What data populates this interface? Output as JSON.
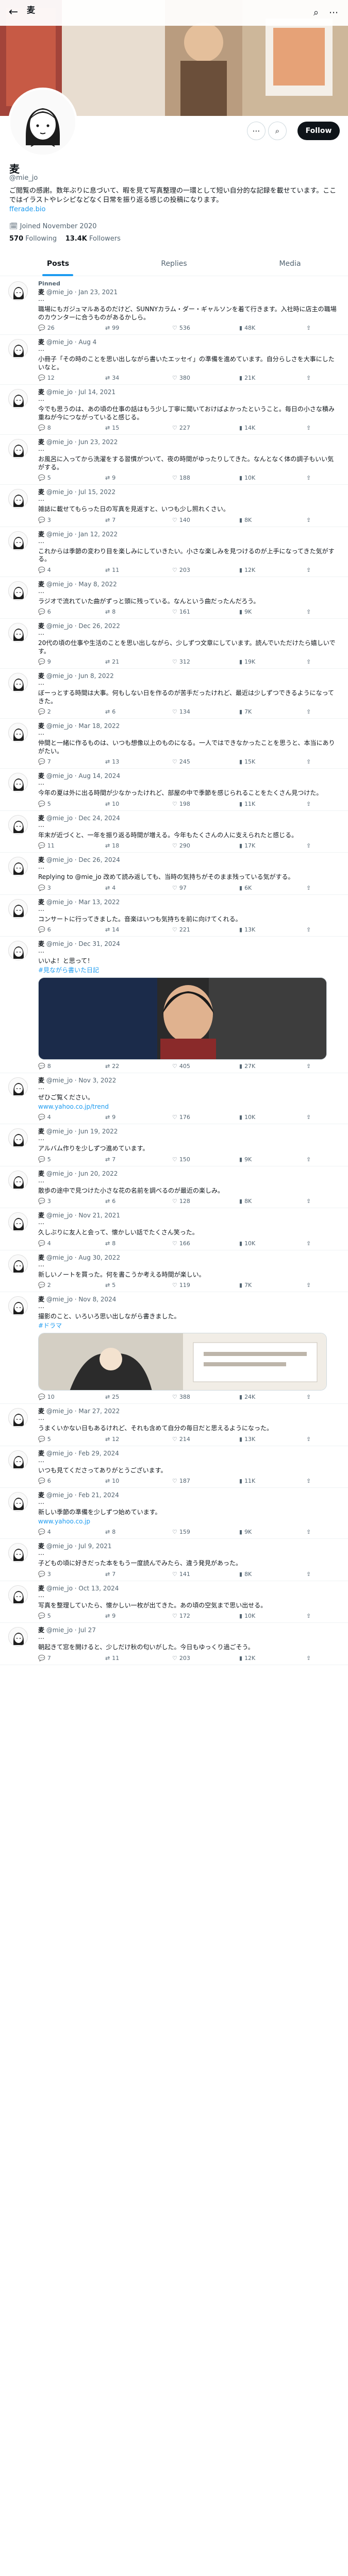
{
  "header": {
    "title": "麦",
    "subtitle": "",
    "back": "←",
    "search": "⌕",
    "more": "⋯"
  },
  "profile": {
    "name": "麦",
    "handle": "@mie_jo",
    "bio": "ご閲覧の感謝。数年ぶりに息づいて、暇を見て写真整理の一環として短い自分的な記録を載せています。ここではイラストやレシピなどなく日常を振り返る感じの投稿になります。",
    "link": "fferade.bio",
    "joined": "Joined November 2020",
    "following": "570",
    "following_label": "Following",
    "followers": "13.4K",
    "followers_label": "Followers",
    "follow_button": "Follow",
    "more_icon": "⋯",
    "search_icon": "⌕",
    "bell_icon": "🔔"
  },
  "tabs": [
    {
      "label": "Posts"
    },
    {
      "label": "Replies"
    },
    {
      "label": "Media"
    }
  ],
  "tweets": [
    {
      "pinned": "Pinned",
      "name": "麦",
      "handle": "@mie_jo",
      "date": "Jan 23, 2021",
      "text": "職場にもガジュマルあるのだけど、SUNNYカラム・ダー・ギャルソンを着て行きます。入社時に店主の職場のカウンターに合うものがあるかしら。",
      "reply": "26",
      "rt": "99",
      "like": "536",
      "view": "48K"
    },
    {
      "name": "麦",
      "handle": "@mie_jo",
      "date": "Aug 4",
      "text": "小冊子「その時のことを思い出しながら書いたエッセイ」の準備を進めています。自分らしさを大事にしたいなと。",
      "reply": "12",
      "rt": "34",
      "like": "380",
      "view": "21K"
    },
    {
      "name": "麦",
      "handle": "@mie_jo",
      "date": "Jul 14, 2021",
      "text": "今でも思うのは、あの頃の仕事の話はもう少し丁寧に聞いておけばよかったということ。毎日の小さな積み重ねが今につながっていると感じる。",
      "reply": "8",
      "rt": "15",
      "like": "227",
      "view": "14K"
    },
    {
      "name": "麦",
      "handle": "@mie_jo",
      "date": "Jun 23, 2022",
      "text": "お風呂に入ってから洗濯をする習慣がついて、夜の時間がゆったりしてきた。なんとなく体の調子もいい気がする。",
      "reply": "5",
      "rt": "9",
      "like": "188",
      "view": "10K"
    },
    {
      "name": "麦",
      "handle": "@mie_jo",
      "date": "Jul 15, 2022",
      "text": "雑誌に載せてもらった日の写真を見返すと、いつも少し照れくさい。",
      "reply": "3",
      "rt": "7",
      "like": "140",
      "view": "8K"
    },
    {
      "name": "麦",
      "handle": "@mie_jo",
      "date": "Jan 12, 2022",
      "text": "これからは季節の変わり目を楽しみにしていきたい。小さな楽しみを見つけるのが上手になってきた気がする。",
      "reply": "4",
      "rt": "11",
      "like": "203",
      "view": "12K"
    },
    {
      "name": "麦",
      "handle": "@mie_jo",
      "date": "May 8, 2022",
      "text": "ラジオで流れていた曲がずっと頭に残っている。なんという曲だったんだろう。",
      "reply": "6",
      "rt": "8",
      "like": "161",
      "view": "9K"
    },
    {
      "name": "麦",
      "handle": "@mie_jo",
      "date": "Dec 26, 2022",
      "text": "20代の頃の仕事や生活のことを思い出しながら、少しずつ文章にしています。読んでいただけたら嬉しいです。",
      "reply": "9",
      "rt": "21",
      "like": "312",
      "view": "19K"
    },
    {
      "name": "麦",
      "handle": "@mie_jo",
      "date": "Jun 8, 2022",
      "text": "ぼーっとする時間は大事。何もしない日を作るのが苦手だったけれど、最近は少しずつできるようになってきた。",
      "reply": "2",
      "rt": "6",
      "like": "134",
      "view": "7K"
    },
    {
      "name": "麦",
      "handle": "@mie_jo",
      "date": "Mar 18, 2022",
      "text": "仲間と一緒に作るものは、いつも想像以上のものになる。一人ではできなかったことを思うと、本当にありがたい。",
      "reply": "7",
      "rt": "13",
      "like": "245",
      "view": "15K"
    },
    {
      "name": "麦",
      "handle": "@mie_jo",
      "date": "Aug 14, 2024",
      "text": "今年の夏は外に出る時間が少なかったけれど、部屋の中で季節を感じられることをたくさん見つけた。",
      "reply": "5",
      "rt": "10",
      "like": "198",
      "view": "11K"
    },
    {
      "name": "麦",
      "handle": "@mie_jo",
      "date": "Dec 24, 2024",
      "text": "年末が近づくと、一年を振り返る時間が増える。今年もたくさんの人に支えられたと感じる。",
      "reply": "11",
      "rt": "18",
      "like": "290",
      "view": "17K"
    },
    {
      "name": "麦",
      "handle": "@mie_jo",
      "date": "Dec 26, 2024",
      "text": "Replying to @mie_jo 改めて読み返しても、当時の気持ちがそのまま残っている気がする。",
      "reply": "3",
      "rt": "4",
      "like": "97",
      "view": "6K"
    },
    {
      "name": "麦",
      "handle": "@mie_jo",
      "date": "Mar 13, 2022",
      "text": "コンサートに行ってきました。音楽はいつも気持ちを前に向けてくれる。",
      "reply": "6",
      "rt": "14",
      "like": "221",
      "view": "13K"
    },
    {
      "name": "麦",
      "handle": "@mie_jo",
      "date": "Dec 31, 2024",
      "text": "いいよ！と思って！",
      "link": "#見ながら書いた日記",
      "reply": "8",
      "rt": "22",
      "like": "405",
      "view": "27K"
    },
    {
      "name": "麦",
      "handle": "@mie_jo",
      "date": "Nov 3, 2022",
      "text": "ぜひご覧ください。",
      "link": "www.yahoo.co.jp/trend",
      "reply": "4",
      "rt": "9",
      "like": "176",
      "view": "10K"
    },
    {
      "name": "麦",
      "handle": "@mie_jo",
      "date": "Jun 19, 2022",
      "text": "アルバム作りを少しずつ進めています。",
      "reply": "5",
      "rt": "7",
      "like": "150",
      "view": "9K"
    },
    {
      "name": "麦",
      "handle": "@mie_jo",
      "date": "Jun 20, 2022",
      "text": "散歩の途中で見つけた小さな花の名前を調べるのが最近の楽しみ。",
      "reply": "3",
      "rt": "6",
      "like": "128",
      "view": "8K"
    },
    {
      "name": "麦",
      "handle": "@mie_jo",
      "date": "Nov 21, 2021",
      "text": "久しぶりに友人と会って、懐かしい話でたくさん笑った。",
      "reply": "4",
      "rt": "8",
      "like": "166",
      "view": "10K"
    },
    {
      "name": "麦",
      "handle": "@mie_jo",
      "date": "Aug 30, 2022",
      "text": "新しいノートを買った。何を書こうか考える時間が楽しい。",
      "reply": "2",
      "rt": "5",
      "like": "119",
      "view": "7K"
    },
    {
      "name": "麦",
      "handle": "@mie_jo",
      "date": "Nov 8, 2024",
      "text": "撮影のこと、いろいろ思い出しながら書きました。",
      "link": "#ドラマ",
      "reply": "10",
      "rt": "25",
      "like": "388",
      "view": "24K"
    },
    {
      "name": "麦",
      "handle": "@mie_jo",
      "date": "Mar 27, 2022",
      "text": "うまくいかない日もあるけれど、それも含めて自分の毎日だと思えるようになった。",
      "reply": "5",
      "rt": "12",
      "like": "214",
      "view": "13K"
    },
    {
      "name": "麦",
      "handle": "@mie_jo",
      "date": "Feb 29, 2024",
      "text": "いつも見てくださってありがとうございます。",
      "reply": "6",
      "rt": "10",
      "like": "187",
      "view": "11K"
    },
    {
      "name": "麦",
      "handle": "@mie_jo",
      "date": "Feb 21, 2024",
      "text": "新しい季節の準備を少しずつ始めています。",
      "link": "www.yahoo.co.jp",
      "reply": "4",
      "rt": "8",
      "like": "159",
      "view": "9K"
    },
    {
      "name": "麦",
      "handle": "@mie_jo",
      "date": "Jul 9, 2021",
      "text": "子どもの頃に好きだった本をもう一度読んでみたら、違う発見があった。",
      "reply": "3",
      "rt": "7",
      "like": "141",
      "view": "8K"
    },
    {
      "name": "麦",
      "handle": "@mie_jo",
      "date": "Oct 13, 2024",
      "text": "写真を整理していたら、懐かしい一枚が出てきた。あの頃の空気まで思い出せる。",
      "reply": "5",
      "rt": "9",
      "like": "172",
      "view": "10K"
    },
    {
      "name": "麦",
      "handle": "@mie_jo",
      "date": "Jul 27",
      "text": "朝起きて窓を開けると、少しだけ秋の匂いがした。今日もゆっくり過ごそう。",
      "reply": "7",
      "rt": "11",
      "like": "203",
      "view": "12K"
    }
  ]
}
